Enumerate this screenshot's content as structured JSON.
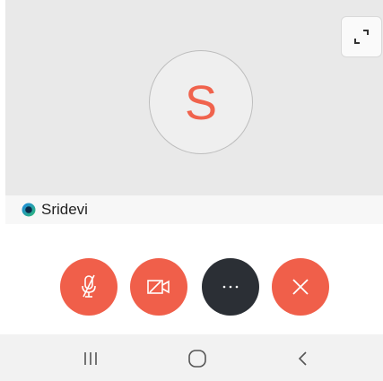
{
  "avatar": {
    "initial": "S",
    "letter_color": "#f0634d"
  },
  "participant": {
    "name": "Sridevi",
    "status_icon": "blue-green-status-dot-icon"
  },
  "controls": {
    "mic_icon": "microphone-muted-icon",
    "video_icon": "video-camera-off-icon",
    "more_label": "···",
    "end_icon": "close-icon",
    "accent_color": "#f05f4a",
    "more_color": "#2b2f35"
  },
  "expand": {
    "icon": "expand-corners-icon"
  },
  "nav": {
    "recents_icon": "recent-apps-icon",
    "home_icon": "home-icon",
    "back_icon": "back-icon"
  }
}
